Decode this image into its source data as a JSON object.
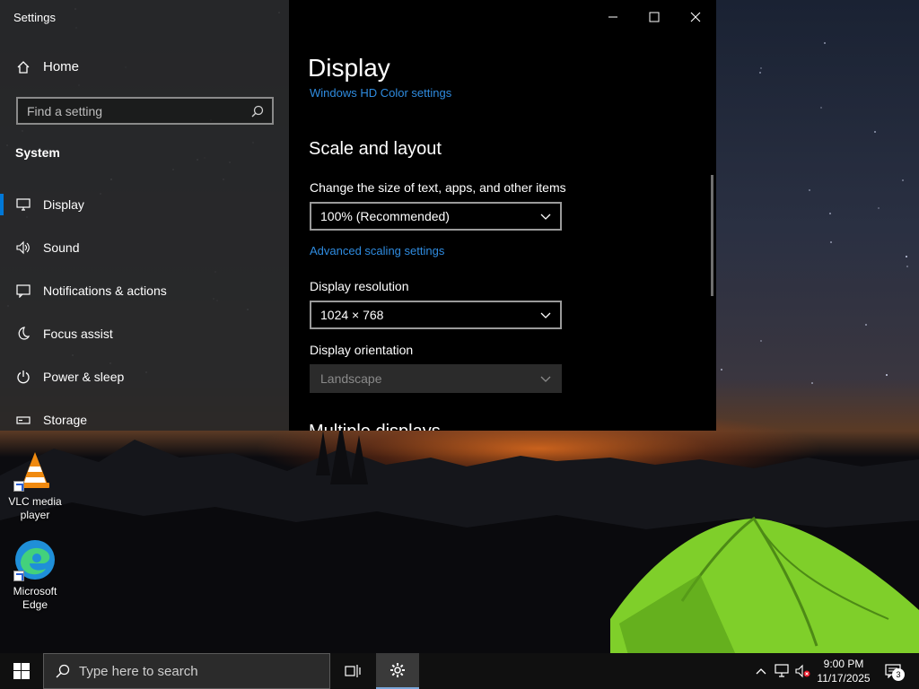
{
  "desktop": {
    "icons": [
      {
        "label_line1": "VLC media",
        "label_line2": "player",
        "icon": "vlc-icon"
      },
      {
        "label_line1": "Microsoft",
        "label_line2": "Edge",
        "icon": "edge-icon"
      }
    ]
  },
  "settings": {
    "window_title": "Settings",
    "home_label": "Home",
    "search_placeholder": "Find a setting",
    "section_label": "System",
    "nav_items": [
      {
        "label": "Display",
        "icon": "monitor-icon",
        "selected": true
      },
      {
        "label": "Sound",
        "icon": "speaker-icon"
      },
      {
        "label": "Notifications & actions",
        "icon": "notification-icon"
      },
      {
        "label": "Focus assist",
        "icon": "moon-icon"
      },
      {
        "label": "Power & sleep",
        "icon": "power-icon"
      },
      {
        "label": "Storage",
        "icon": "storage-icon"
      }
    ],
    "page_title": "Display",
    "hd_color_link": "Windows HD Color settings",
    "scale_section_title": "Scale and layout",
    "scale_label": "Change the size of text, apps, and other items",
    "scale_value": "100% (Recommended)",
    "advanced_scaling_link": "Advanced scaling settings",
    "resolution_label": "Display resolution",
    "resolution_value": "1024 × 768",
    "orientation_label": "Display orientation",
    "orientation_value": "Landscape",
    "next_section_partial": "Multiple displays"
  },
  "taskbar": {
    "search_placeholder": "Type here to search",
    "time": "9:00 PM",
    "date": "11/17/2025",
    "notification_count": "3",
    "accent_color": "#0078d7"
  }
}
